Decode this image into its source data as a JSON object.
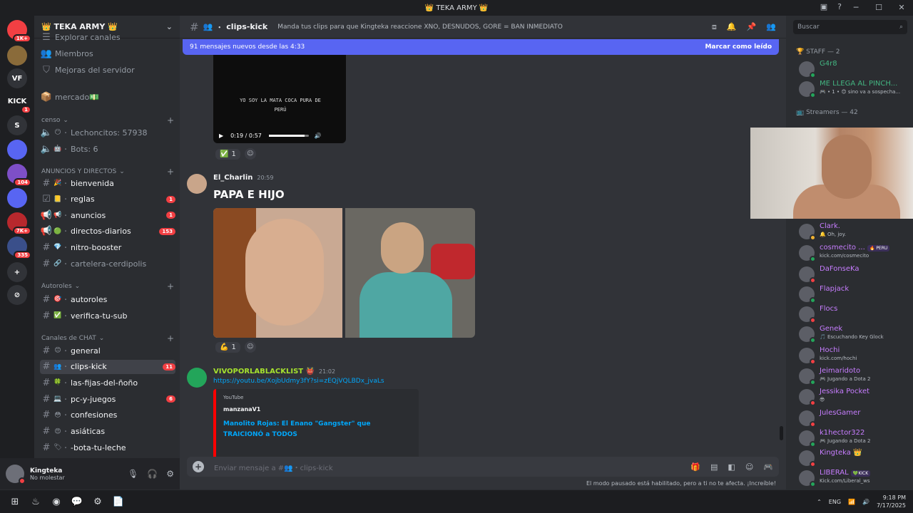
{
  "window": {
    "title": "👑 TEKA ARMY 👑",
    "controls": [
      "─",
      "☐",
      "✕"
    ]
  },
  "servers": [
    {
      "label": "",
      "badge": "1K+",
      "color": "#f23f43"
    },
    {
      "label": "",
      "badge": "",
      "color": "#8a6b3a"
    },
    {
      "label": "VF",
      "badge": "",
      "color": "#313338"
    },
    {
      "label": "KICK",
      "badge": "1",
      "color": "#1e1f22"
    },
    {
      "label": "S",
      "badge": "",
      "color": "#313338"
    },
    {
      "label": "",
      "badge": "",
      "color": "#5865f2"
    },
    {
      "label": "",
      "badge": "104",
      "color": "#7e4fc7"
    },
    {
      "label": "",
      "badge": "",
      "color": "#5865f2"
    },
    {
      "label": "",
      "badge": "7K+",
      "color": "#b8282d"
    },
    {
      "label": "",
      "badge": "335",
      "color": "#3a4f8a"
    },
    {
      "label": "+",
      "badge": "",
      "color": "#313338"
    },
    {
      "label": "⊘",
      "badge": "",
      "color": "#313338"
    }
  ],
  "guild": {
    "name": "👑 TEKA ARMY 👑"
  },
  "sidebar": {
    "top_items": [
      {
        "icon": "☰",
        "label": "Explorar canales"
      },
      {
        "icon": "👥",
        "label": "Miembros"
      },
      {
        "icon": "⛉",
        "label": "Mejoras del servidor"
      }
    ],
    "mercado": {
      "icon": "📦",
      "label": "mercado💵"
    },
    "censo": {
      "label": "censo",
      "items": [
        {
          "icon": "🔈",
          "emoji": "😶",
          "label": "Lechoncitos: 57938"
        },
        {
          "icon": "🔈",
          "emoji": "🤖",
          "label": "Bots: 6"
        }
      ]
    },
    "anuncios": {
      "label": "ANUNCIOS Y DIRECTOS",
      "items": [
        {
          "icon": "#",
          "emoji": "🎉",
          "label": "bienvenida",
          "badge": "",
          "unread": true
        },
        {
          "icon": "☑",
          "emoji": "📒",
          "label": "reglas",
          "badge": "1",
          "unread": true
        },
        {
          "icon": "📢",
          "emoji": "📢",
          "label": "anuncios",
          "badge": "1",
          "unread": true
        },
        {
          "icon": "📢",
          "emoji": "🟢",
          "label": "directos-diarios",
          "badge": "153",
          "unread": true
        },
        {
          "icon": "#",
          "emoji": "💎",
          "label": "nitro-booster",
          "badge": "",
          "unread": true
        },
        {
          "icon": "#",
          "emoji": "🔗",
          "label": "cartelera-cerdipolis",
          "badge": "",
          "unread": false
        }
      ]
    },
    "autoroles": {
      "label": "Autoroles",
      "items": [
        {
          "icon": "#",
          "emoji": "🎯",
          "label": "autoroles",
          "badge": "",
          "unread": true
        },
        {
          "icon": "#",
          "emoji": "✅",
          "label": "verifica-tu-sub",
          "badge": "",
          "unread": true
        }
      ]
    },
    "chat": {
      "label": "Canales de CHAT",
      "items": [
        {
          "icon": "#",
          "emoji": "😊",
          "label": "general",
          "badge": "",
          "unread": true
        },
        {
          "icon": "#",
          "emoji": "👥",
          "label": "clips-kick",
          "badge": "11",
          "unread": true,
          "active": true
        },
        {
          "icon": "#",
          "emoji": "🍀",
          "label": "las-fijas-del-ñoño",
          "badge": "",
          "unread": true
        },
        {
          "icon": "#",
          "emoji": "💻",
          "label": "pc-y-juegos",
          "badge": "6",
          "unread": true
        },
        {
          "icon": "#",
          "emoji": "😳",
          "label": "confesiones",
          "badge": "",
          "unread": true
        },
        {
          "icon": "#",
          "emoji": "😍",
          "label": "asiáticas",
          "badge": "",
          "unread": true
        },
        {
          "icon": "#",
          "emoji": "🏷",
          "label": "-bota-tu-leche",
          "badge": "",
          "unread": true
        }
      ]
    }
  },
  "user": {
    "name": "Kingteka",
    "status": "No molestar"
  },
  "channel": {
    "name": "clips-kick",
    "emoji": "👥",
    "topic": "Manda tus clips para que Kingteka reaccione XNO, DESNUDOS, GORE = BAN INMEDIATO"
  },
  "new_messages": {
    "text": "91 mensajes nuevos desde las 4:33",
    "action": "Marcar como leído"
  },
  "video": {
    "caption": "YO SOY LA MATA COCA PURA DE PERÚ",
    "time": "0:19 / 0:57",
    "progress": 0.9,
    "reaction": "✅",
    "reaction_count": "1"
  },
  "messages": [
    {
      "author": "El_Charlin",
      "color": "#f2f3f5",
      "time": "20:59",
      "text": "PAPA E HIJO",
      "reaction": "💪",
      "reaction_count": "1"
    },
    {
      "author": "VIVOPORLABLACKLIST",
      "badge": "👹",
      "color": "#a6e22e",
      "time": "21:02",
      "link": "https://youtu.be/XojbUdmy3fY?si=zEQjVQLBDx_jvaLs",
      "embed": {
        "provider": "YouTube",
        "author": "manzanaV1",
        "title": "Manolito Rojas: El Enano \"Gangster\" que TRAICIONÓ a TODOS"
      }
    }
  ],
  "composer": {
    "placeholder": "Enviar mensaje a #👥・clips-kick"
  },
  "paused_notice": "El modo pausado está habilitado, pero a ti no te afecta. ¡Increíble!",
  "members": {
    "search_placeholder": "Buscar",
    "groups": [
      {
        "label": "🏆 STAFF — 2"
      },
      {
        "label": "📺 Streamers — 42"
      }
    ],
    "list": [
      {
        "name": "G4r8",
        "status": "",
        "color": "#43b581",
        "dot": "#23a55a"
      },
      {
        "name": "ME LLEGA AL PINCH...",
        "status": "🎮 • 1 • 😊 sino va a sospecha...",
        "color": "#43b581",
        "dot": "#23a55a"
      },
      {
        "name": "Clark.",
        "status": "🔔 Oh, joy.",
        "color": "#c77dff",
        "dot": "#f0b232"
      },
      {
        "name": "cosmecito ...",
        "status": "kick.com/cosmecito",
        "color": "#c77dff",
        "dot": "#23a55a",
        "tag": "🔥 PERU"
      },
      {
        "name": "DaFonseKa",
        "status": "",
        "color": "#c77dff",
        "dot": "#f23f43"
      },
      {
        "name": "Flapjack",
        "status": "",
        "color": "#c77dff",
        "dot": "#23a55a"
      },
      {
        "name": "Flocs",
        "status": "",
        "color": "#c77dff",
        "dot": "#f23f43"
      },
      {
        "name": "Genek",
        "status": "🎵 Escuchando Key Glock",
        "color": "#c77dff",
        "dot": "#23a55a"
      },
      {
        "name": "Hochi",
        "status": "kick.com/hochi",
        "color": "#c77dff",
        "dot": "#f23f43"
      },
      {
        "name": "Jeimaridoto",
        "status": "🎮 Jugando a Dota 2",
        "color": "#c77dff",
        "dot": "#23a55a"
      },
      {
        "name": "Jessika Pocket",
        "status": "😎",
        "color": "#c77dff",
        "dot": "#f23f43"
      },
      {
        "name": "JulesGamer",
        "status": "",
        "color": "#c77dff",
        "dot": "#f23f43"
      },
      {
        "name": "k1hector322",
        "status": "🎮 Jugando a Dota 2",
        "color": "#c77dff",
        "dot": "#23a55a"
      },
      {
        "name": "Kingteka 👑",
        "status": "",
        "color": "#c77dff",
        "dot": "#f23f43"
      },
      {
        "name": "LIBERAL",
        "status": "Kick.com/Liberal_ws",
        "color": "#c77dff",
        "dot": "#23a55a",
        "tag": "💚KICK"
      }
    ]
  },
  "taskbar": {
    "lang": "ENG",
    "time": "9:18 PM",
    "date": "7/17/2025",
    "apps": [
      "⊞",
      "♨",
      "◉",
      "💬",
      "⚙",
      "📄"
    ]
  }
}
